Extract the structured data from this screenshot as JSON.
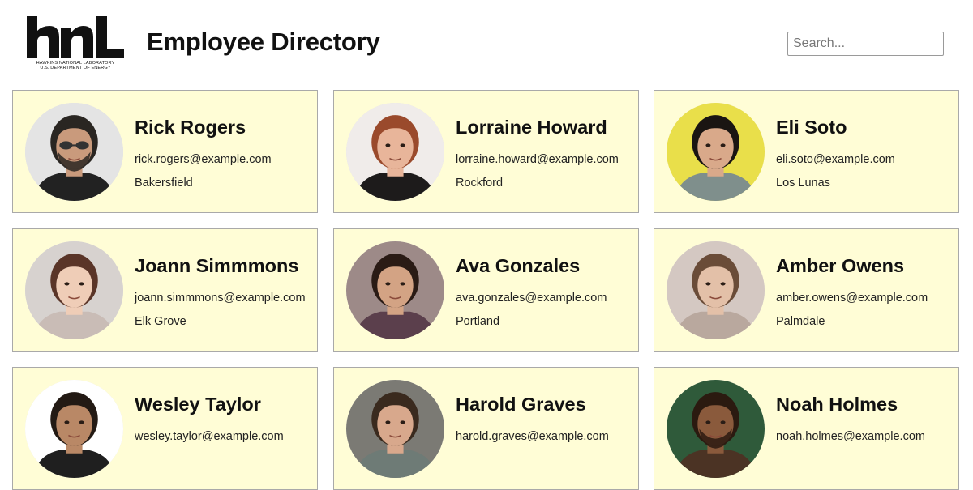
{
  "header": {
    "logo_text": "hnl",
    "logo_line1": "HAWKINS NATIONAL LABORATORY",
    "logo_line2": "U.S. DEPARTMENT OF ENERGY",
    "title": "Employee Directory",
    "search_placeholder": "Search..."
  },
  "employees": [
    {
      "name": "Rick Rogers",
      "email": "rick.rogers@example.com",
      "city": "Bakersfield",
      "avatar": {
        "bg": "#e4e4e4",
        "skin": "#c99a7c",
        "hair": "#2a2622",
        "shirt": "#222222",
        "glasses": true,
        "beard": true
      }
    },
    {
      "name": "Lorraine Howard",
      "email": "lorraine.howard@example.com",
      "city": "Rockford",
      "avatar": {
        "bg": "#f0ecea",
        "skin": "#e8b59a",
        "hair": "#9a4a2c",
        "shirt": "#1d1b1b",
        "glasses": false,
        "beard": false
      }
    },
    {
      "name": "Eli Soto",
      "email": "eli.soto@example.com",
      "city": "Los Lunas",
      "avatar": {
        "bg": "#e9df4a",
        "skin": "#d9a98a",
        "hair": "#1a1512",
        "shirt": "#7f8f8c",
        "glasses": false,
        "beard": false
      }
    },
    {
      "name": "Joann Simmmons",
      "email": "joann.simmmons@example.com",
      "city": "Elk Grove",
      "avatar": {
        "bg": "#d7d2cf",
        "skin": "#efcdb7",
        "hair": "#5a3528",
        "shirt": "#c9bcb6",
        "glasses": false,
        "beard": false
      }
    },
    {
      "name": "Ava Gonzales",
      "email": "ava.gonzales@example.com",
      "city": "Portland",
      "avatar": {
        "bg": "#9d8a88",
        "skin": "#d3a384",
        "hair": "#2a1b15",
        "shirt": "#5b3f4c",
        "glasses": false,
        "beard": false
      }
    },
    {
      "name": "Amber Owens",
      "email": "amber.owens@example.com",
      "city": "Palmdale",
      "avatar": {
        "bg": "#d4c8c2",
        "skin": "#e3c0a8",
        "hair": "#6a4c38",
        "shirt": "#b9a89e",
        "glasses": false,
        "beard": false
      }
    },
    {
      "name": "Wesley Taylor",
      "email": "wesley.taylor@example.com",
      "city": "",
      "avatar": {
        "bg": "#ffffff",
        "skin": "#b98866",
        "hair": "#231a14",
        "shirt": "#1f1f1f",
        "glasses": false,
        "beard": false
      }
    },
    {
      "name": "Harold Graves",
      "email": "harold.graves@example.com",
      "city": "",
      "avatar": {
        "bg": "#7b7a74",
        "skin": "#d8a88c",
        "hair": "#3a2a1e",
        "shirt": "#6e7b76",
        "glasses": false,
        "beard": false
      }
    },
    {
      "name": "Noah Holmes",
      "email": "noah.holmes@example.com",
      "city": "",
      "avatar": {
        "bg": "#2f5a3a",
        "skin": "#8a5a3c",
        "hair": "#2b1a10",
        "shirt": "#4b3324",
        "glasses": false,
        "beard": true
      }
    }
  ]
}
